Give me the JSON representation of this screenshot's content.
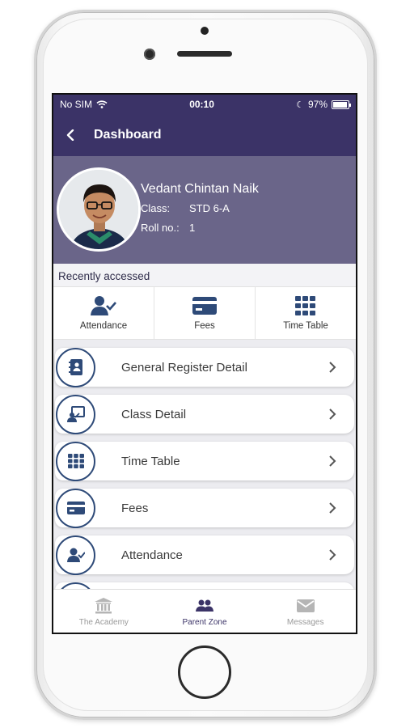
{
  "status": {
    "carrier": "No SIM",
    "time": "00:10",
    "battery": "97%"
  },
  "nav": {
    "title": "Dashboard"
  },
  "student": {
    "name": "Vedant Chintan Naik",
    "class_key": "Class:",
    "class_value": "STD 6-A",
    "roll_key": "Roll no.:",
    "roll_value": "1"
  },
  "recent": {
    "title": "Recently accessed",
    "items": [
      {
        "label": "Attendance",
        "icon": "attendance-icon"
      },
      {
        "label": "Fees",
        "icon": "fees-card-icon"
      },
      {
        "label": "Time Table",
        "icon": "grid-icon"
      }
    ]
  },
  "menu": [
    {
      "label": "General Register Detail",
      "icon": "contact-book-icon"
    },
    {
      "label": "Class Detail",
      "icon": "class-presentation-icon"
    },
    {
      "label": "Time Table",
      "icon": "grid-icon"
    },
    {
      "label": "Fees",
      "icon": "fees-card-icon"
    },
    {
      "label": "Attendance",
      "icon": "attendance-icon"
    }
  ],
  "tabs": [
    {
      "label": "The Academy",
      "icon": "institution-icon",
      "active": false
    },
    {
      "label": "Parent Zone",
      "icon": "parents-icon",
      "active": true
    },
    {
      "label": "Messages",
      "icon": "envelope-icon",
      "active": false
    }
  ],
  "colors": {
    "primary": "#3b3367",
    "profile_bg": "#6a6589",
    "icon_blue": "#2e4a78"
  }
}
